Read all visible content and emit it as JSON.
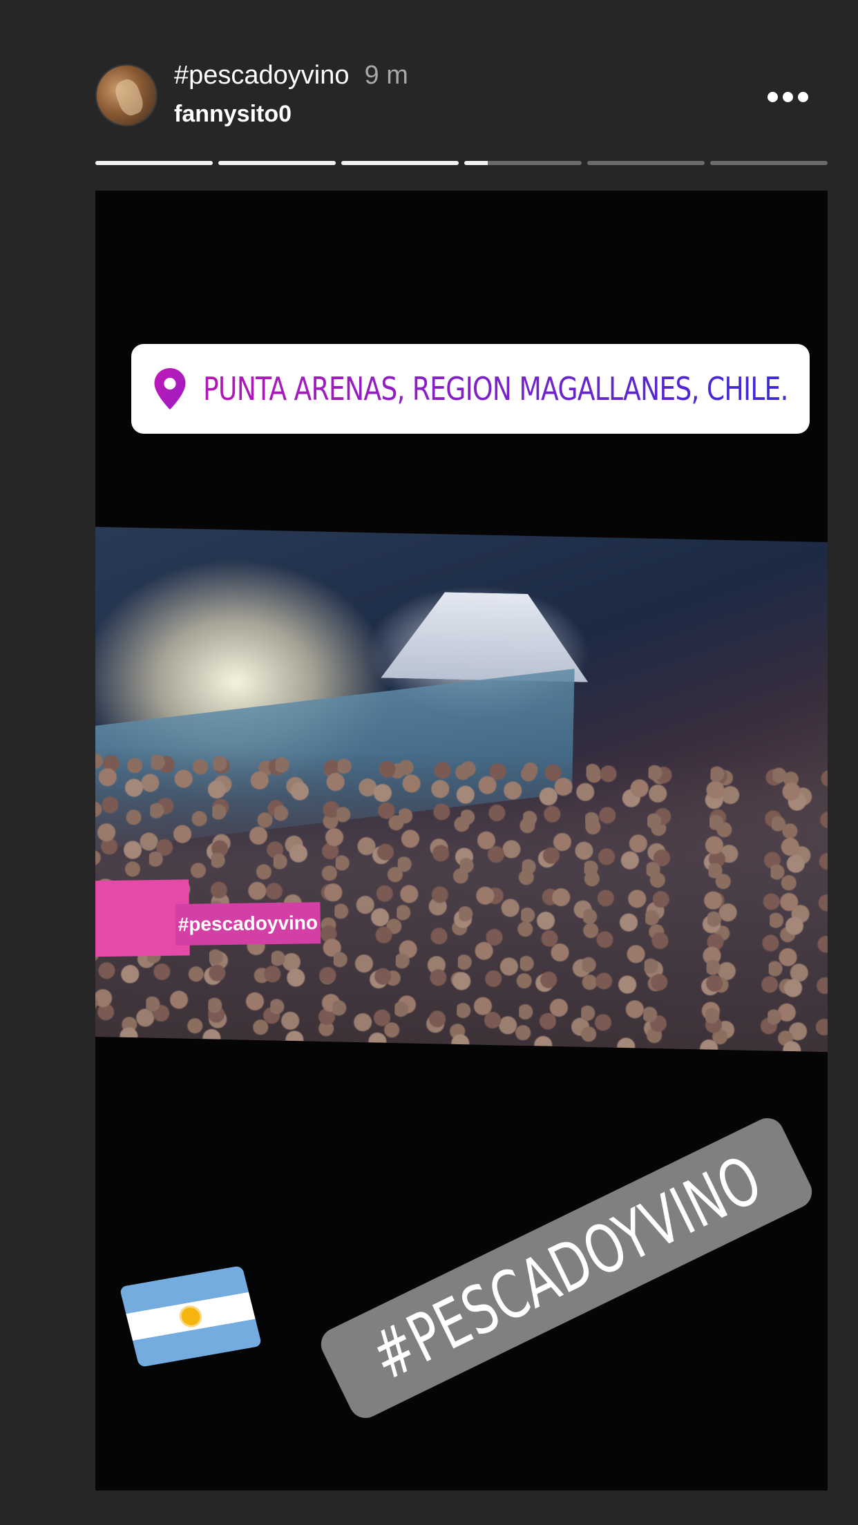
{
  "header": {
    "title": "#pescadoyvino",
    "time_ago": "9 m",
    "username": "fannysito0"
  },
  "progress": {
    "segments": [
      1,
      1,
      1,
      0.2,
      0,
      0
    ]
  },
  "story": {
    "location_sticker": "PUNTA ARENAS, REGION MAGALLANES, CHILE.",
    "video_overlay_tag": "#pescadoyvino",
    "hashtag_sticker": "#PESCADOYVINO",
    "emoji": "argentina-flag"
  },
  "colors": {
    "background": "#262626",
    "location_gradient_start": "#b417b4",
    "location_gradient_end": "#3a2ad6"
  }
}
